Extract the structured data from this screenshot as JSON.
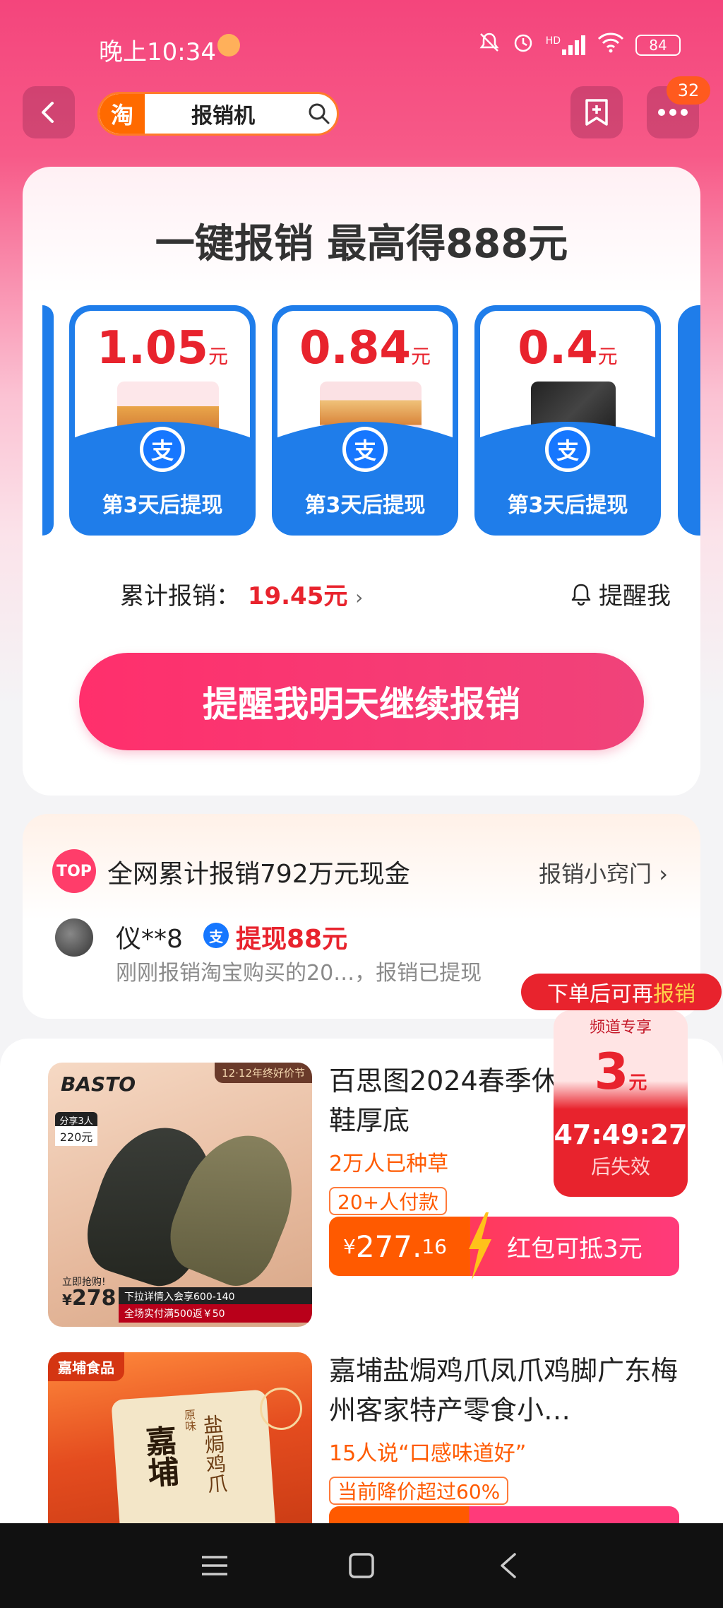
{
  "status_bar": {
    "time": "晚上10:34",
    "network": "HD",
    "battery": "84"
  },
  "nav": {
    "search_logo": "淘",
    "search_text": "报销机",
    "notification_count": "32"
  },
  "main": {
    "headline": "一键报销 最高得888元",
    "coupons": [
      {
        "amount": "1.05",
        "unit": "元",
        "label": "第3天后提现",
        "icon": "alipay-icon"
      },
      {
        "amount": "0.84",
        "unit": "元",
        "label": "第3天后提现",
        "icon": "alipay-icon"
      },
      {
        "amount": "0.4",
        "unit": "元",
        "label": "第3天后提现",
        "icon": "alipay-icon"
      }
    ],
    "total_label": "累计报销：",
    "total_value": "19.45元",
    "remind_label": "提醒我",
    "cta": "提醒我明天继续报销"
  },
  "info": {
    "top_badge": "TOP",
    "title": "全网累计报销792万元现金",
    "link": "报销小窍门",
    "user_name": "仪**8",
    "user_action": "提现88元",
    "user_desc": "刚刚报销淘宝购买的20…，报销已提现"
  },
  "promo": {
    "tag_prefix": "下单后可再",
    "tag_highlight": "报销",
    "ribbon": "频道专享",
    "amount": "3",
    "unit": "元",
    "timer": "47:49:27",
    "expire": "后失效"
  },
  "products": [
    {
      "title": "百思图2024春季休闲运动板鞋厚底",
      "subtitle": "2万人已种草",
      "tag": "20+人付款",
      "price_symbol": "¥",
      "price_main": "277.",
      "price_decimal": "16",
      "promo": "红包可抵3元",
      "image": {
        "brand": "BASTO",
        "corner": "12·12年终好价节",
        "share_label": "分享3人领",
        "share_value": "220元",
        "bottom_line": "下拉详情入会享600-140",
        "bottom_line2": "全场实付满500返￥50",
        "price": "278",
        "price_prefix": "¥"
      }
    },
    {
      "title": "嘉埔盐焗鸡爪凤爪鸡脚广东梅州客家特产零食小…",
      "subtitle": "15人说“口感味道好”",
      "tag": "当前降价超过60%",
      "image": {
        "brand": "嘉埔食品",
        "pack_text": "嘉埔",
        "pack_sub": "盐焗鸡爪",
        "pack_small": "原味"
      }
    }
  ],
  "colors": {
    "accent": "#f4457c",
    "price_red": "#e8232d",
    "alipay": "#1677ff",
    "coupon_blue": "#1f7dea",
    "orange": "#ff5a00"
  }
}
